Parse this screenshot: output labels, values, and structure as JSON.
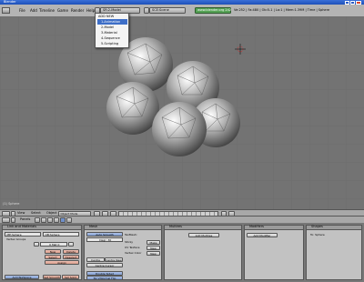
{
  "window": {
    "title": "Blender"
  },
  "header": {
    "menus": [
      "File",
      "Add",
      "Timeline",
      "Game",
      "Render",
      "Help"
    ],
    "screen_field": "SR:2-Model",
    "scene_field": "SCE:Scene",
    "website": "www.blender.org 242",
    "stats": "Ve:252 | Fa:480 | Ob:5-1 | La:1 | Mem:1.39M | Time | Sphere"
  },
  "dropdown": {
    "title": "ADD NEW",
    "items": [
      "1-Animation",
      "2-Model",
      "3-Material",
      "4-Sequence",
      "5-Scripting"
    ],
    "selected": "1-Animation"
  },
  "viewport": {
    "label": "(1) Sphere"
  },
  "view_header": {
    "menus": [
      "View",
      "Select",
      "Object"
    ],
    "mode": "Object Mode"
  },
  "buttons_header": {
    "panels_label": "Panels"
  },
  "panels": {
    "link_materials": {
      "title": "Link and Materials",
      "me_field": "ME:Sphere",
      "ob_field": "OB:Sphere",
      "vertex_groups": "Vertex Groups",
      "mat_field": "0 Mat 0",
      "new": "New",
      "delete": "Delete",
      "select": "Select",
      "deselect": "Deselect",
      "assign": "Assign",
      "auto_tex_space": "AutoTexSpace",
      "set_smooth": "Set Smooth",
      "set_solid": "Set Solid"
    },
    "mesh": {
      "title": "Mesh",
      "auto_smooth": "Auto Smooth",
      "degr": "Degr: 30",
      "sticky": "Sticky",
      "uv_texface": "UV Texface",
      "vertex_color": "Vertex Color",
      "tex_mesh": "TexMesh:",
      "make": "Make",
      "new": "New",
      "new2": "New",
      "centre": "Centre",
      "centre_new": "Centre New",
      "centre_cursor": "Centre Cursor",
      "double_sided": "Double Sided",
      "no_v_normal_flip": "No V.Normal Flip"
    },
    "modifiers": {
      "title": "Modifiers",
      "add_modifier": "Add Modifier"
    },
    "shapes": {
      "title": "Shapes",
      "add_shape": "Add Shape Key"
    },
    "multires": {
      "title": "Multires",
      "add_multires": "Add Multires"
    },
    "to_sphere": {
      "label": "To: Sphere"
    }
  },
  "colors": {
    "title_bar": "#2a5cc8",
    "website_badge": "#55a255",
    "selection": "#3d6ec7",
    "viewport_bg": "#737373"
  }
}
